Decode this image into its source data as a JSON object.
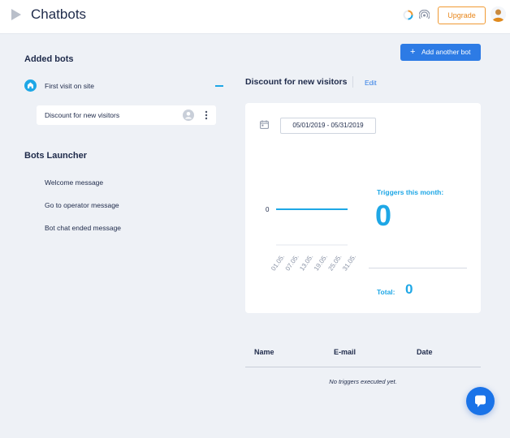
{
  "header": {
    "title": "Chatbots",
    "upgrade_label": "Upgrade",
    "icons": [
      "play-icon",
      "spinner-icon",
      "signal-icon",
      "avatar"
    ]
  },
  "sidebar": {
    "added_title": "Added bots",
    "first_visit": "First visit on site",
    "bot_item": "Discount for new visitors",
    "launcher_title": "Bots Launcher",
    "launcher_items": [
      "Welcome message",
      "Go to operator message",
      "Bot chat ended message"
    ]
  },
  "main": {
    "add_button": "Add another bot",
    "bot_title": "Discount for new visitors",
    "edit_label": "Edit",
    "date_range": "05/01/2019 - 05/31/2019",
    "triggers_label": "Triggers this month:",
    "triggers_value": "0",
    "total_label": "Total:",
    "total_value": "0",
    "table_headers": [
      "Name",
      "E-mail",
      "Date"
    ],
    "empty_message": "No triggers executed yet."
  },
  "chart_data": {
    "type": "line",
    "x": [
      "01.05.",
      "07.05.",
      "13.05.",
      "19.05.",
      "25.05.",
      "31.05."
    ],
    "series": [
      {
        "values": [
          0,
          0,
          0,
          0,
          0,
          0
        ]
      }
    ],
    "y_ticks": [
      "0"
    ],
    "color": "#1ea7e6"
  },
  "colors": {
    "accent": "#1ea7e6",
    "primary_button": "#2d7be5",
    "upgrade": "#f09a33"
  }
}
